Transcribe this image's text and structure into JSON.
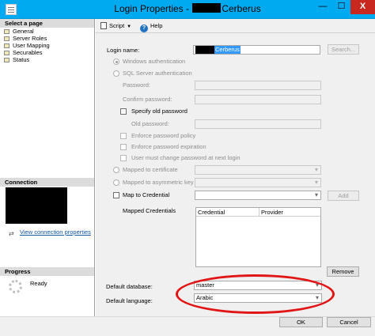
{
  "window": {
    "title_prefix": "Login Properties - ",
    "title_suffix": "Cerberus",
    "minimize_glyph": "—",
    "maximize_glyph": "☐",
    "close_glyph": "X"
  },
  "sidebar": {
    "select_page_heading": "Select a page",
    "pages": [
      "General",
      "Server Roles",
      "User Mapping",
      "Securables",
      "Status"
    ],
    "connection_heading": "Connection",
    "view_connection_link": "View connection properties",
    "progress_heading": "Progress",
    "progress_status": "Ready"
  },
  "toolbar": {
    "script_label": "Script",
    "help_label": "Help",
    "help_glyph": "?"
  },
  "general": {
    "login_name_label": "Login name:",
    "login_name_value": "Cerberus",
    "search_button": "Search...",
    "windows_auth_label": "Windows authentication",
    "sql_auth_label": "SQL Server authentication",
    "password_label": "Password:",
    "confirm_password_label": "Confirm password:",
    "specify_old_password_label": "Specify old password",
    "old_password_label": "Old password:",
    "enforce_policy_label": "Enforce password policy",
    "enforce_expiration_label": "Enforce password expiration",
    "must_change_label": "User must change password at next login",
    "mapped_certificate_label": "Mapped to certificate",
    "mapped_asym_key_label": "Mapped to asymmetric key",
    "map_credential_label": "Map to Credential",
    "add_button": "Add",
    "mapped_credentials_label": "Mapped Credentials",
    "credentials_columns": [
      "Credential",
      "Provider"
    ],
    "remove_button": "Remove",
    "default_database_label": "Default database:",
    "default_database_value": "master",
    "default_language_label": "Default language:",
    "default_language_value": "Arabic"
  },
  "footer": {
    "ok_button": "OK",
    "cancel_button": "Cancel"
  },
  "colors": {
    "title_bar": "#00aaf0",
    "close_button": "#c9281e",
    "highlight_ellipse": "#e11515",
    "selection": "#3399ff"
  }
}
